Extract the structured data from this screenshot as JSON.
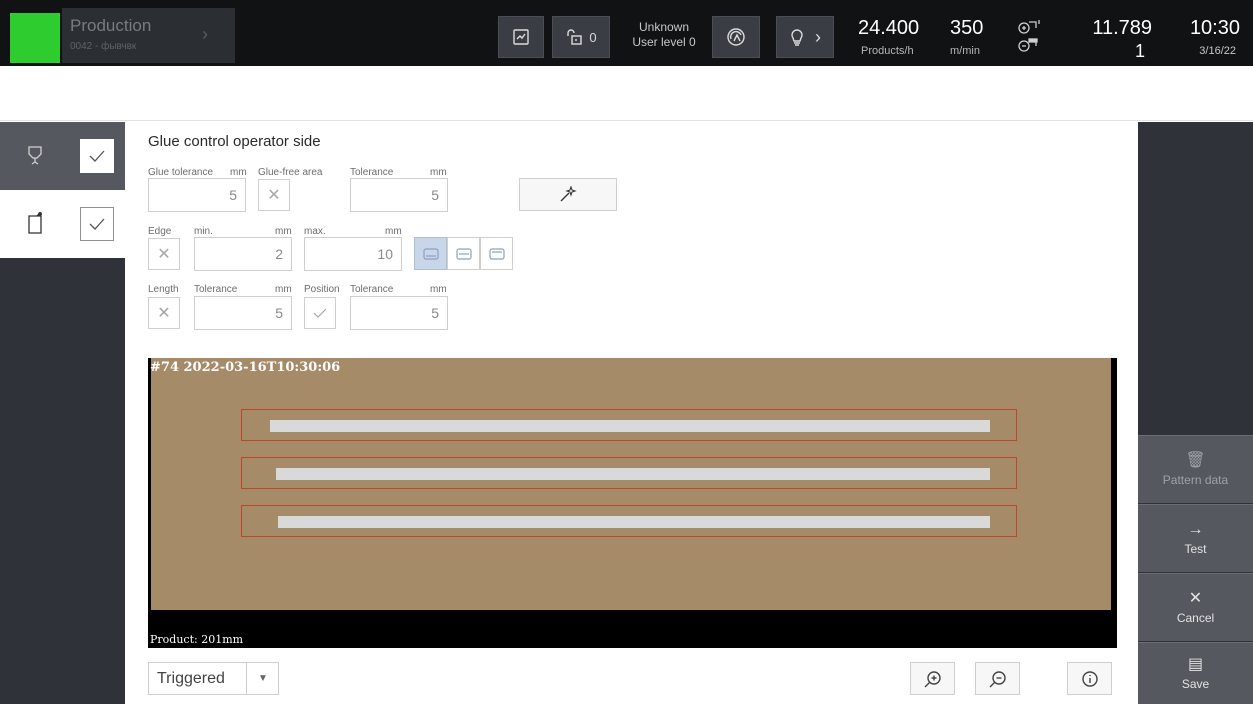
{
  "header": {
    "status_color": "#2ecc2e",
    "production_title": "Production",
    "production_sub": "0042 - фывчвк",
    "lock_count": "0",
    "user_name": "Unknown",
    "user_level": "User level 0",
    "speed_products": "24.400",
    "speed_products_unit": "Products/h",
    "speed_belt": "350",
    "speed_belt_unit": "m/min",
    "counter_total": "11.789",
    "counter_sub": "1",
    "time": "10:30",
    "date": "3/16/22",
    "icons": [
      "note-icon",
      "lock-icon",
      "waste-icon",
      "lightbulb-icon",
      "chevron-right-icon",
      "rev-up-icon",
      "rev-down-icon"
    ]
  },
  "left_tabs": [
    {
      "icon": "glue-nozzle-icon",
      "checked": true
    },
    {
      "icon": "document-icon",
      "checked": true
    }
  ],
  "right_buttons": {
    "pattern_data": "Pattern data",
    "test": "Test",
    "cancel": "Cancel",
    "save": "Save"
  },
  "panel": {
    "title": "Glue control operator side",
    "glue_tolerance_label": "Glue tolerance",
    "glue_tolerance_unit": "mm",
    "glue_tolerance_value": "5",
    "glue_free_label": "Glue-free area",
    "tolerance_label": "Tolerance",
    "tolerance_unit": "mm",
    "tolerance_value": "5",
    "edge_label": "Edge",
    "min_label": "min.",
    "min_unit": "mm",
    "min_value": "2",
    "max_label": "max.",
    "max_unit": "mm",
    "max_value": "10",
    "length_label": "Length",
    "length_tol_label": "Tolerance",
    "length_tol_unit": "mm",
    "length_tol_value": "5",
    "position_label": "Position",
    "position_tol_label": "Tolerance",
    "position_tol_unit": "mm",
    "position_tol_value": "5"
  },
  "viewer": {
    "caption_top": "#74 2022-03-16T10:30:06",
    "caption_bottom": "Product: 201mm",
    "carton_color": "#a68b68",
    "frame_color": "#c0452b"
  },
  "footer": {
    "trigger_value": "Triggered"
  }
}
